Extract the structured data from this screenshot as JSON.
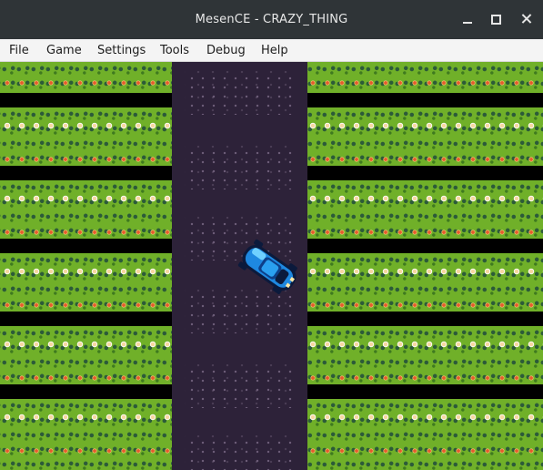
{
  "window": {
    "title": "MesenCE - CRAZY_THING",
    "controls": [
      "minimize-icon",
      "maximize-icon",
      "close-icon"
    ]
  },
  "menu": {
    "items": [
      "File",
      "Game",
      "Settings",
      "Tools",
      "Debug",
      "Help"
    ]
  },
  "game": {
    "colors": {
      "grass": "#70b029",
      "grass_dark": "#2c5b39",
      "road": "#2d2239",
      "car_body": "#1e88e0",
      "car_outline": "#0b1a3c",
      "separator": "#000000"
    },
    "sprites": [
      "car-sprite",
      "grass-tile",
      "road-tile",
      "flower-tile"
    ]
  }
}
